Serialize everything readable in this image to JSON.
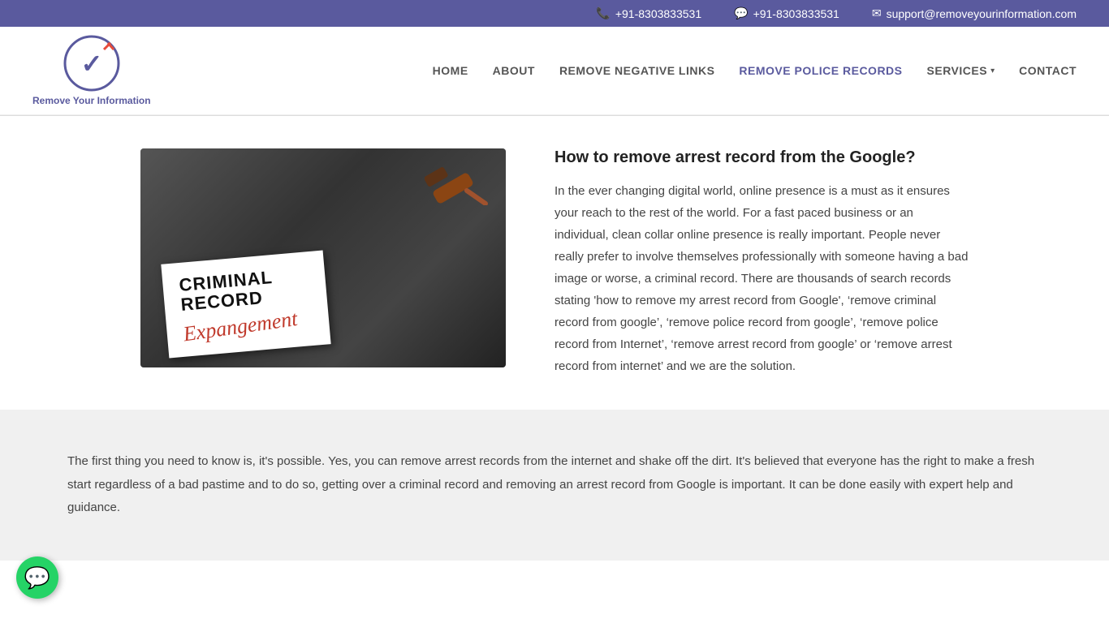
{
  "topbar": {
    "phone1": "+91-8303833531",
    "phone2": "+91-8303833531",
    "email": "support@removeyourinformation.com",
    "phone_icon": "📞",
    "whatsapp_icon": "💬",
    "email_icon": "✉"
  },
  "logo": {
    "text": "Remove Your Information"
  },
  "nav": {
    "items": [
      {
        "label": "HOME",
        "active": false
      },
      {
        "label": "ABOUT",
        "active": false
      },
      {
        "label": "REMOVE NEGATIVE LINKS",
        "active": false
      },
      {
        "label": "REMOVE POLICE RECORDS",
        "active": true
      },
      {
        "label": "SERVICES",
        "active": false,
        "has_dropdown": true
      },
      {
        "label": "CONTACT",
        "active": false
      }
    ]
  },
  "article": {
    "heading": "How to remove arrest record from the Google?",
    "body": "In the ever changing digital world, online presence is a must as it ensures your reach to the rest of the world. For a fast paced business or an individual, clean collar online presence is really important. People never really prefer to involve themselves professionally with someone having a bad image or worse, a criminal record. There are thousands of search records stating 'how to remove my arrest record from Google', ‘remove criminal record from google’, ‘remove police record from google’, ‘remove police record from Internet’, ‘remove arrest record from google’ or ‘remove arrest record from internet’ and we are the solution.",
    "image_alt": "Criminal Record Expungement"
  },
  "footer_section": {
    "body": "The first thing you need to know is, it's possible. Yes, you can remove arrest records from the internet and shake off the dirt. It's believed that everyone has the right to make a fresh start regardless of a bad pastime and to do so, getting over a criminal record and removing an arrest record from Google is important. It can be done easily with expert help and guidance."
  }
}
